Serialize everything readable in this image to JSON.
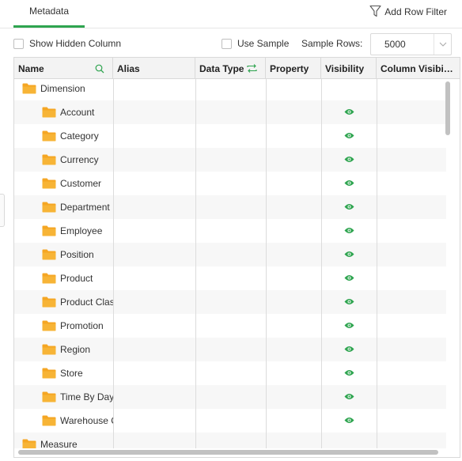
{
  "tabs": {
    "active_label": "Metadata"
  },
  "toolbar": {
    "add_row_filter": "Add Row Filter"
  },
  "options": {
    "show_hidden_column": "Show Hidden Column",
    "use_sample": "Use Sample",
    "sample_rows_label": "Sample Rows:",
    "sample_rows_value": "5000"
  },
  "grid": {
    "columns": [
      "Name",
      "Alias",
      "Data Type",
      "Property",
      "Visibility",
      "Column Visibi…"
    ],
    "rows": [
      {
        "name": "Dimension",
        "level": 0,
        "visible": false
      },
      {
        "name": "Account",
        "level": 1,
        "visible": true
      },
      {
        "name": "Category",
        "level": 1,
        "visible": true
      },
      {
        "name": "Currency",
        "level": 1,
        "visible": true
      },
      {
        "name": "Customer",
        "level": 1,
        "visible": true
      },
      {
        "name": "Department",
        "level": 1,
        "visible": true
      },
      {
        "name": "Employee",
        "level": 1,
        "visible": true
      },
      {
        "name": "Position",
        "level": 1,
        "visible": true
      },
      {
        "name": "Product",
        "level": 1,
        "visible": true
      },
      {
        "name": "Product Clas",
        "level": 1,
        "visible": true
      },
      {
        "name": "Promotion",
        "level": 1,
        "visible": true
      },
      {
        "name": "Region",
        "level": 1,
        "visible": true
      },
      {
        "name": "Store",
        "level": 1,
        "visible": true
      },
      {
        "name": "Time By Day",
        "level": 1,
        "visible": true
      },
      {
        "name": "Warehouse C",
        "level": 1,
        "visible": true
      },
      {
        "name": "Measure",
        "level": 0,
        "visible": false
      }
    ]
  },
  "colors": {
    "accent": "#2ea44f",
    "folder": "#f5a623"
  },
  "icons": {
    "filter": "funnel-icon",
    "search": "search-icon",
    "convert": "swap-icon",
    "folder": "folder-icon",
    "visibility": "eye-icon"
  }
}
